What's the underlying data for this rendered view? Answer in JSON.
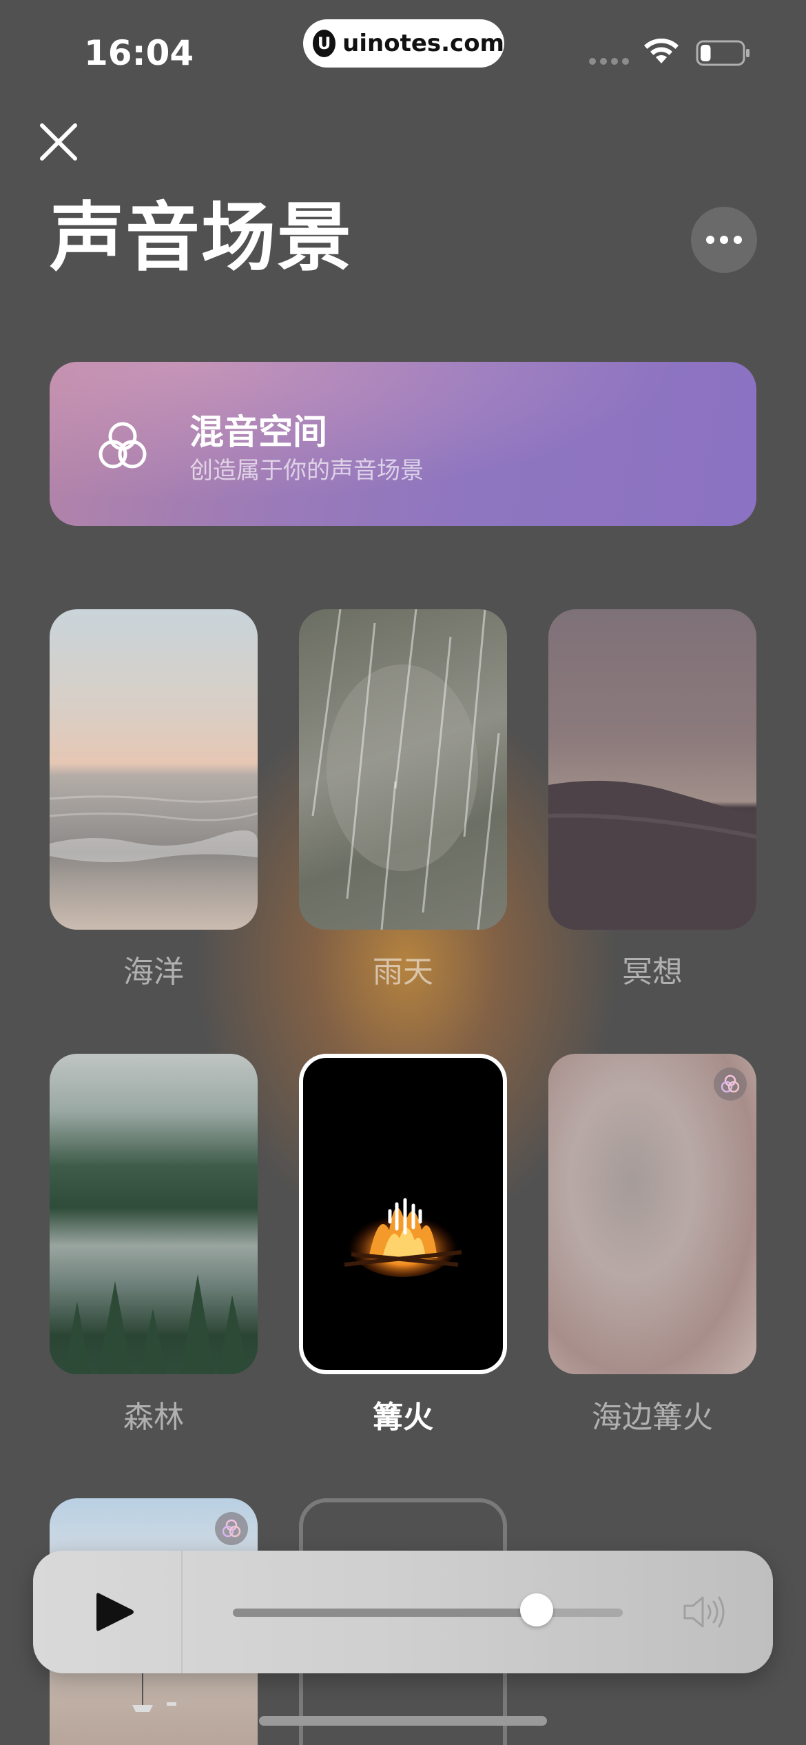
{
  "status_bar": {
    "time": "16:04",
    "watermark": "uinotes.com",
    "watermark_logo": "U",
    "battery_level": 0.25
  },
  "header": {
    "title": "声音场景",
    "close_icon": "close-icon",
    "more_icon": "more-icon"
  },
  "mix_banner": {
    "title": "混音空间",
    "subtitle": "创造属于你的声音场景",
    "icon": "mix-circles-icon"
  },
  "scenes": [
    {
      "label": "海洋",
      "active": false
    },
    {
      "label": "雨天",
      "active": false
    },
    {
      "label": "冥想",
      "active": false
    },
    {
      "label": "森林",
      "active": false
    },
    {
      "label": "篝火",
      "active": true
    },
    {
      "label": "海边篝火",
      "active": false,
      "mixed": true
    }
  ],
  "player": {
    "play_icon": "play-icon",
    "volume": 0.78,
    "speaker_icon": "speaker-icon"
  },
  "colors": {
    "background": "#515151",
    "banner_start": "#b384a8",
    "banner_end": "#8c72c2",
    "glow": "#c78c3c"
  }
}
